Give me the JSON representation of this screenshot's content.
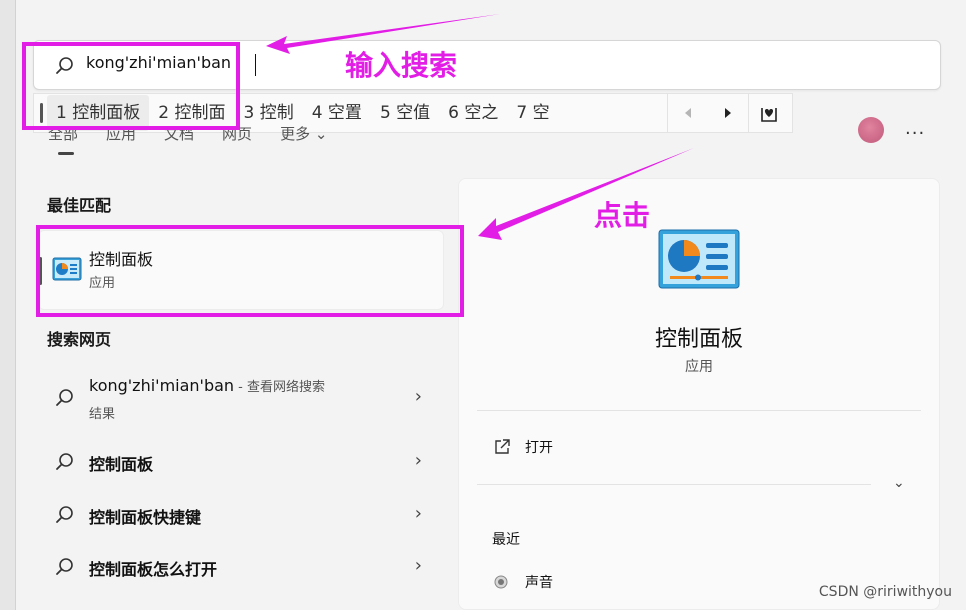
{
  "search": {
    "value": "kong'zhi'mian'ban"
  },
  "ime": {
    "candidates": [
      {
        "label": "1 控制面板"
      },
      {
        "label": "2 控制面"
      },
      {
        "label": "3 控制"
      },
      {
        "label": "4 空置"
      },
      {
        "label": "5 空值"
      },
      {
        "label": "6 空之"
      },
      {
        "label": "7 空"
      }
    ],
    "prev_icon": "triangle-left-icon",
    "next_icon": "triangle-right-icon",
    "fav_icon": "heart-box-icon"
  },
  "tabs": [
    "全部",
    "应用",
    "文档",
    "网页",
    "更多 ⌄"
  ],
  "best_match": {
    "title": "最佳匹配",
    "name": "控制面板",
    "type": "应用"
  },
  "web": {
    "title": "搜索网页",
    "items": [
      {
        "text": "kong'zhi'mian'ban",
        "suffix": " - 查看网络搜索",
        "sub": "结果"
      },
      {
        "text": "控制面板"
      },
      {
        "text": "控制面板快捷键"
      },
      {
        "text": "控制面板怎么打开"
      }
    ]
  },
  "detail": {
    "name": "控制面板",
    "type": "应用",
    "open_label": "打开",
    "recent_title": "最近",
    "recent_item": "声音"
  },
  "annotations": {
    "type_hint": "输入搜索",
    "click_hint": "点击",
    "color": "#e21ee6"
  },
  "more_label": "...",
  "watermark": "CSDN @ririwithyou"
}
